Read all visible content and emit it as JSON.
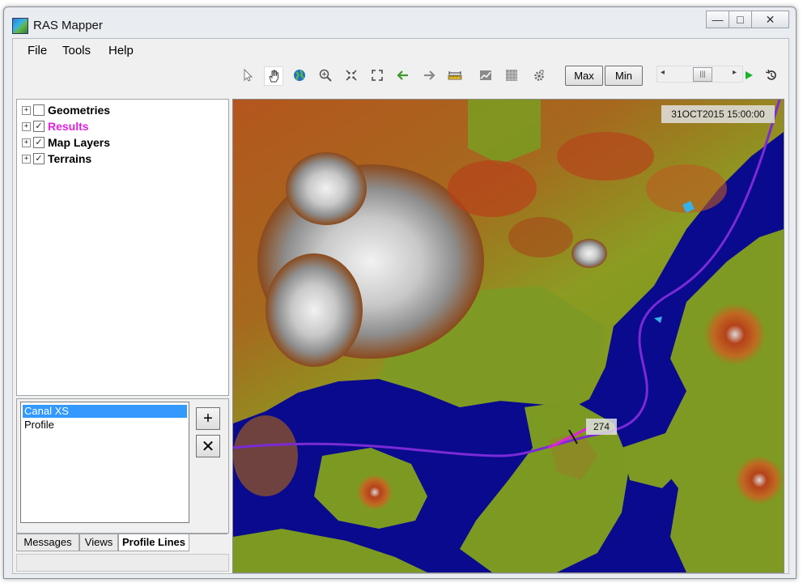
{
  "window": {
    "title": "RAS Mapper"
  },
  "window_controls": {
    "minimize": "—",
    "maximize": "□",
    "close": "✕"
  },
  "menu": [
    "File",
    "Tools",
    "Help"
  ],
  "toolbar": {
    "icons": [
      "pointer-icon",
      "pan-hand-icon",
      "globe-icon",
      "zoom-in-icon",
      "zoom-extents-icon",
      "full-extent-icon",
      "back-arrow-icon",
      "forward-arrow-icon",
      "measure-ruler-icon",
      "profile-plot-icon",
      "raster-icon",
      "settings-gear-icon"
    ],
    "max_label": "Max",
    "min_label": "Min",
    "scroll_left": "◂",
    "scroll_right": "▸",
    "scroll_thumb": "|||"
  },
  "layer_tree": [
    {
      "label": "Geometries",
      "checked": false,
      "expander": "+",
      "color": "#000000"
    },
    {
      "label": "Results",
      "checked": true,
      "expander": "+",
      "color": "#e020e0"
    },
    {
      "label": "Map Layers",
      "checked": true,
      "expander": "+",
      "color": "#000000"
    },
    {
      "label": "Terrains",
      "checked": true,
      "expander": "+",
      "color": "#000000"
    }
  ],
  "checkmark": "✓",
  "profile_list": {
    "items": [
      {
        "label": "Canal XS",
        "selected": true
      },
      {
        "label": "Profile",
        "selected": false
      }
    ],
    "add_label": "+",
    "remove_label": "✕"
  },
  "bottom_tabs": [
    {
      "label": "Messages",
      "active": false
    },
    {
      "label": "Views",
      "active": false
    },
    {
      "label": "Profile Lines",
      "active": true
    }
  ],
  "map": {
    "time_label": "31OCT2015 15:00:00",
    "value_label": "274",
    "water_color": "#0a0a8e",
    "profile_line_color": "#7b2ad6"
  }
}
